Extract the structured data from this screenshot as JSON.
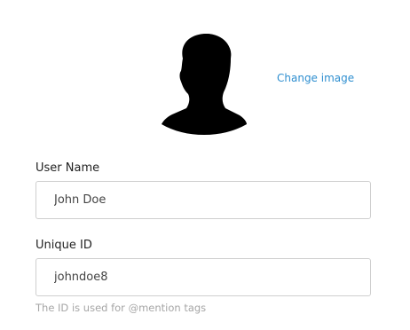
{
  "profile": {
    "avatar_icon": "user-silhouette-icon",
    "change_image_label": "Change image"
  },
  "form": {
    "user_name": {
      "label": "User Name",
      "value": "John Doe"
    },
    "unique_id": {
      "label": "Unique ID",
      "value": "johndoe8",
      "hint": "The ID is used for @mention tags"
    }
  },
  "colors": {
    "link": "#2f8fd0",
    "input_border": "#cfcfcf",
    "hint": "#a6a6a6"
  }
}
